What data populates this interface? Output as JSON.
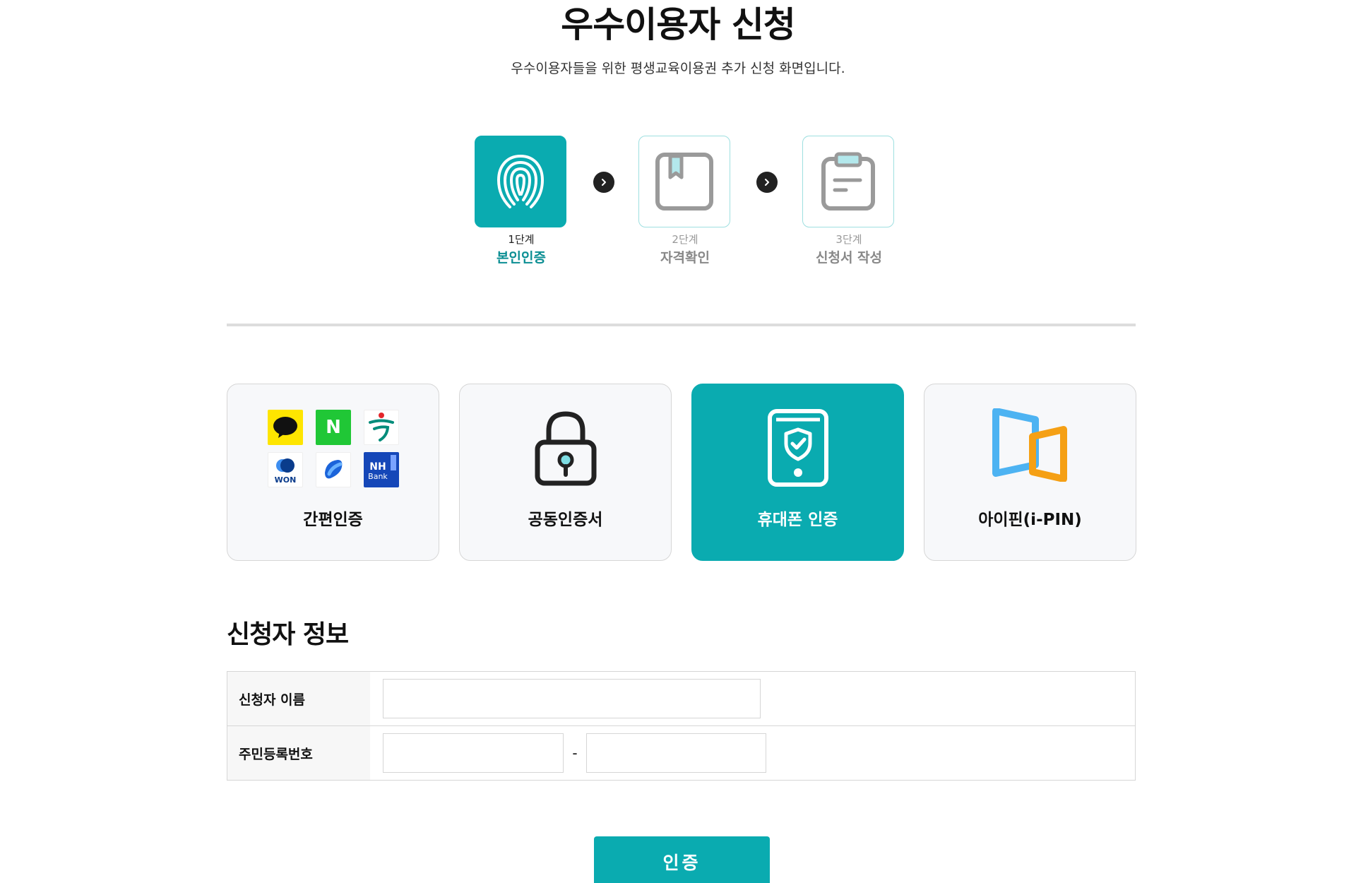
{
  "header": {
    "title": "우수이용자 신청",
    "subtitle": "우수이용자들을 위한 평생교육이용권 추가 신청 화면입니다."
  },
  "steps": [
    {
      "number": "1단계",
      "label": "본인인증",
      "icon": "fingerprint-icon",
      "active": true
    },
    {
      "number": "2단계",
      "label": "자격확인",
      "icon": "bookmark-icon",
      "active": false
    },
    {
      "number": "3단계",
      "label": "신청서 작성",
      "icon": "clipboard-icon",
      "active": false
    }
  ],
  "auth_methods": [
    {
      "label": "간편인증",
      "icon": "simple-auth-logos-icon",
      "selected": false
    },
    {
      "label": "공동인증서",
      "icon": "lock-icon",
      "selected": false
    },
    {
      "label": "휴대폰 인증",
      "icon": "phone-shield-icon",
      "selected": true
    },
    {
      "label": "아이핀(i-PIN)",
      "icon": "ipin-icon",
      "selected": false
    }
  ],
  "simple_auth_logos": {
    "kakao": "kakao-icon",
    "naver": {
      "icon": "naver-icon",
      "text": "N"
    },
    "hana": "hana-bank-icon",
    "woori": {
      "icon": "woori-won-icon",
      "text": "WON"
    },
    "toss": "toss-icon",
    "nh": {
      "icon": "nh-bank-icon",
      "text": "NH",
      "subtext": "Bank"
    }
  },
  "applicant": {
    "section_title": "신청자 정보",
    "name_label": "신청자 이름",
    "name_value": "",
    "rrn_label": "주민등록번호",
    "rrn_front_value": "",
    "rrn_back_value": "",
    "rrn_separator": "-"
  },
  "submit": {
    "label": "인증"
  },
  "colors": {
    "accent": "#0aabb0",
    "step_active_text": "#0b8e93",
    "inactive_text": "#888888",
    "card_bg": "#f7f8fa"
  }
}
